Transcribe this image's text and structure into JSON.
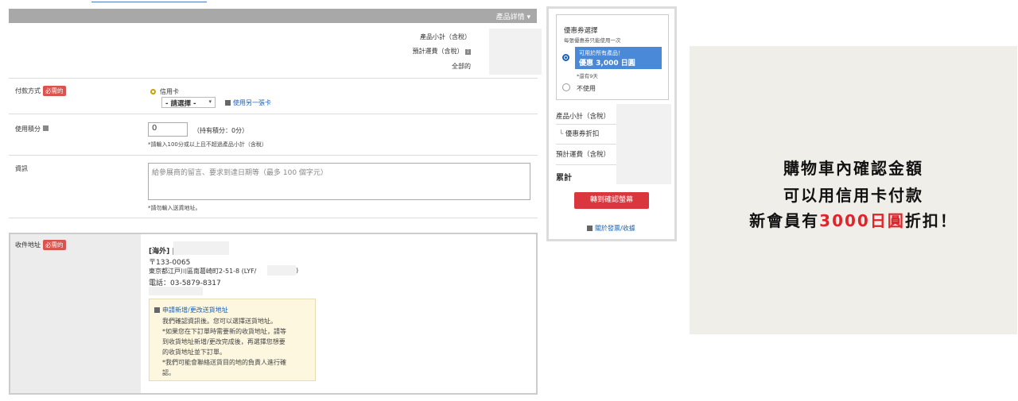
{
  "summary": {
    "bar_label": "產品詳情 ▾",
    "subtotal_label": "產品小計（含稅）",
    "shipping_label": "預計運費（含稅）",
    "total_label": "全部的"
  },
  "payment": {
    "label": "付款方式",
    "required": "必需的",
    "option": "信用卡",
    "select_value": "- 請選擇 -",
    "other_card_link": "使用另一張卡"
  },
  "points": {
    "label": "使用積分",
    "value": "0",
    "held": "（持有積分：0分）",
    "note": "*請輸入100分或以上且不超過產品小計（含稅）"
  },
  "info": {
    "label": "資訊",
    "placeholder": "給參展商的留言、要求到達日期等（最多 100 個字元）",
    "note": "*請勿輸入送貨地址。"
  },
  "address": {
    "label": "收件地址",
    "required": "必需的",
    "region": "[海外]",
    "postal": "〒133-0065",
    "street": "東京都江戸川區南葛崎町2-51-8 (LYF/",
    "street_end": ")",
    "phone": "電話：03-5879-8317",
    "note_link": "申請新增/更改送貨地址",
    "note_lines": [
      "我們確認資訊後。您可以選擇送貨地址。",
      "*如果您在下訂單時需要新的收貨地址，請等",
      "到收貨地址新增/更改完成後，再選擇您想要",
      "的收貨地址並下訂單。",
      "*我們可能會聯絡送貨目的地的負責人進行確",
      "認。"
    ]
  },
  "coupon": {
    "title": "優惠券選擇",
    "sub": "每張優惠券只能使用一次",
    "selected_line1": "可用於所有產品！",
    "selected_line2": "優惠 3,000 日圓",
    "remaining": "*還有9天",
    "none": "不使用"
  },
  "panel": {
    "subtotal": "產品小計（含稅）",
    "discount": "優惠券折扣",
    "shipping": "預計運費（含稅）",
    "total": "累計",
    "confirm_button": "轉到確認螢幕",
    "invoice_link": "關於發票/收據"
  },
  "promo": {
    "line1": "購物車內確認金額",
    "line2": "可以用信用卡付款",
    "line3_a": "新會員有",
    "line3_b": "3000日圓",
    "line3_c": "折扣！"
  },
  "colors": {
    "accent": "#1a5fb4",
    "required": "#d9534f",
    "confirm": "#d9363e",
    "coupon_selected": "#4a88d8",
    "promo_red": "#e0242b"
  }
}
